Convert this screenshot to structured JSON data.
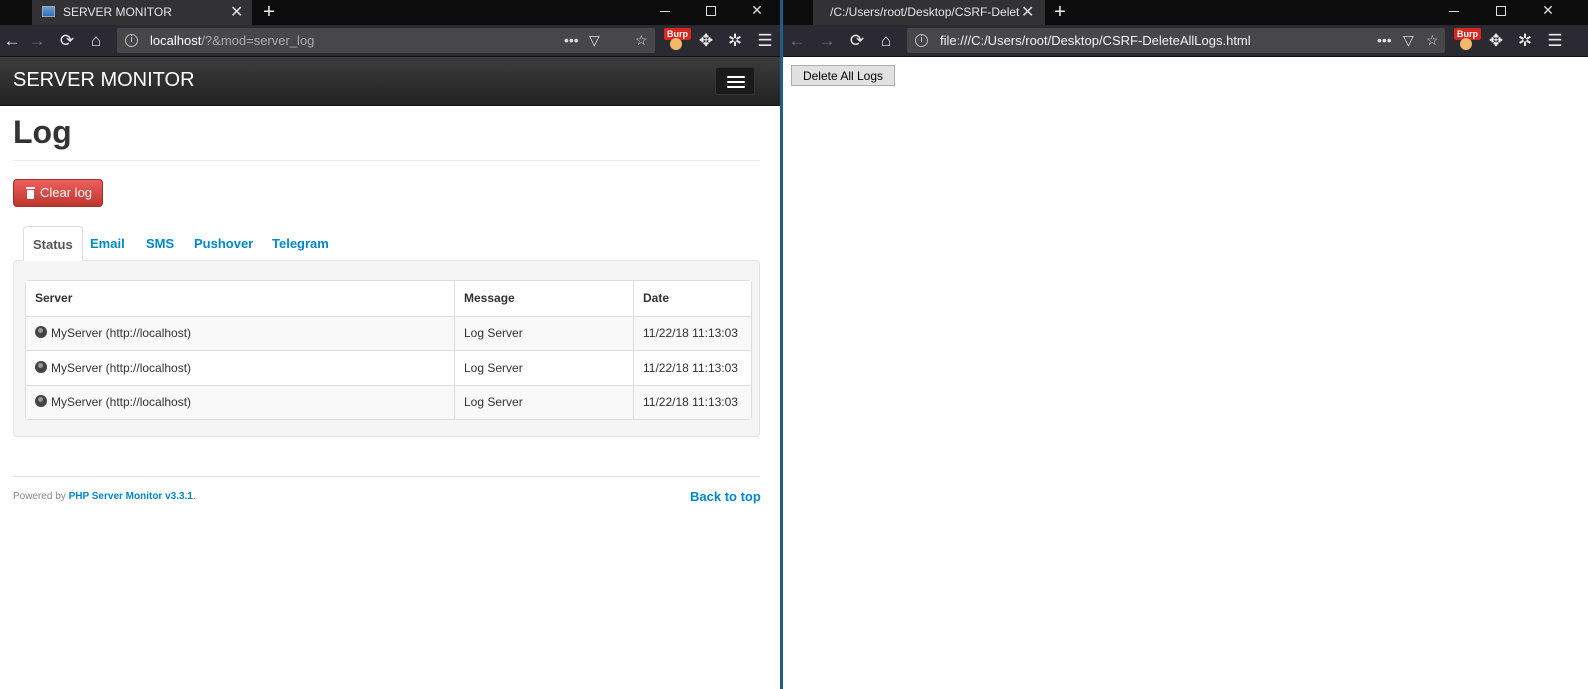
{
  "left_window": {
    "tab": {
      "title": "SERVER MONITOR",
      "close": "✕"
    },
    "new_tab": "+",
    "controls": {
      "close": "✕"
    },
    "nav": {
      "back": "←",
      "forward": "→",
      "reload": "⟳",
      "home": "⌂",
      "menu": "☰"
    },
    "url": {
      "host": "localhost",
      "path": "/?&mod=server_log",
      "more": "•••"
    },
    "burp_label": "Burp",
    "app": {
      "brand": "SERVER MONITOR",
      "heading": "Log",
      "clear_button": "Clear log",
      "tabs": [
        {
          "label": "Status",
          "active": true
        },
        {
          "label": "Email",
          "active": false
        },
        {
          "label": "SMS",
          "active": false
        },
        {
          "label": "Pushover",
          "active": false
        },
        {
          "label": "Telegram",
          "active": false
        }
      ],
      "table": {
        "headers": [
          "Server",
          "Message",
          "Date"
        ],
        "rows": [
          {
            "server": "MyServer (http://localhost)",
            "message": "Log Server",
            "date": "11/22/18 11:13:03"
          },
          {
            "server": "MyServer (http://localhost)",
            "message": "Log Server",
            "date": "11/22/18 11:13:03"
          },
          {
            "server": "MyServer (http://localhost)",
            "message": "Log Server",
            "date": "11/22/18 11:13:03"
          }
        ]
      },
      "footer": {
        "powered_by": "Powered by",
        "product": "PHP Server Monitor v3.3.1",
        "period": ".",
        "back_to_top": "Back to top"
      }
    }
  },
  "right_window": {
    "tab": {
      "title": "/C:/Users/root/Desktop/CSRF-Delet",
      "close": "✕"
    },
    "new_tab": "+",
    "controls": {
      "close": "✕"
    },
    "nav": {
      "back": "←",
      "forward": "→",
      "reload": "⟳",
      "home": "⌂",
      "menu": "☰"
    },
    "url": {
      "full": "file:///C:/Users/root/Desktop/CSRF-DeleteAllLogs.html",
      "more": "•••"
    },
    "burp_label": "Burp",
    "page": {
      "delete_button": "Delete All Logs"
    }
  },
  "colors": {
    "tabbar": "#0c0c0d",
    "active_tab": "#323234",
    "toolbar": "#2b2a33",
    "urlbar": "#474749",
    "app_header": "#222222",
    "danger": "#da4f49",
    "link": "#0088cc"
  }
}
